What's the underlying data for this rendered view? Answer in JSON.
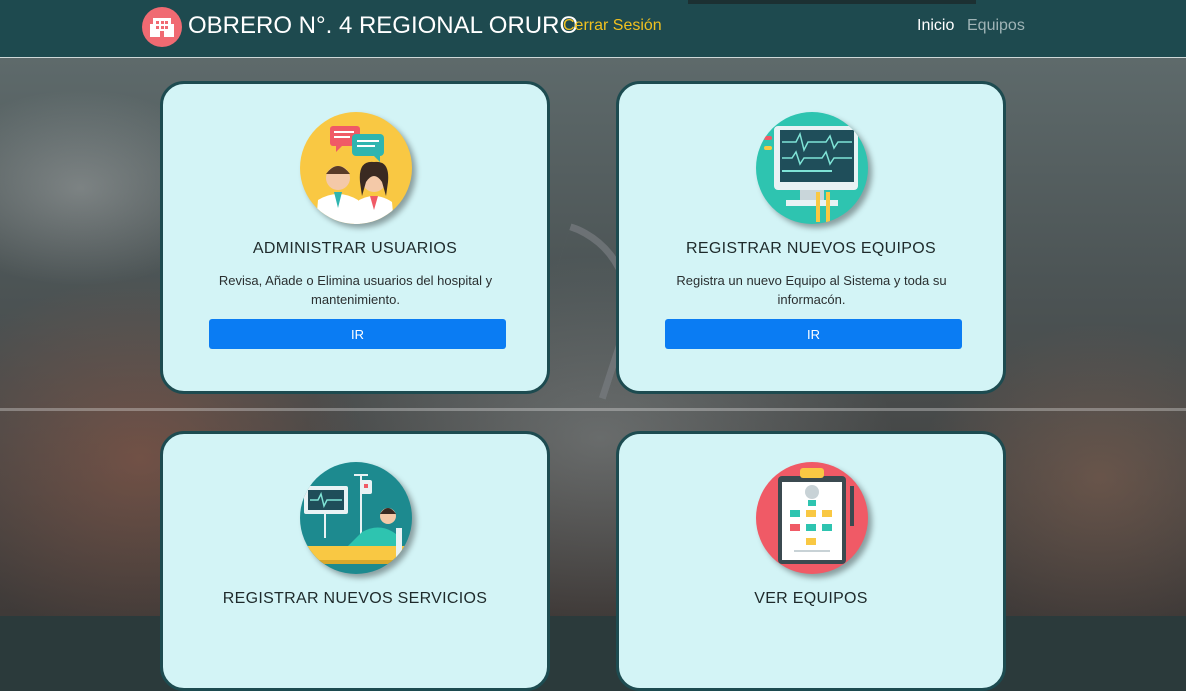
{
  "navbar": {
    "brand_title": "OBRERO N°. 4 REGIONAL ORURO",
    "logout_label": "Cerrar Sesión",
    "links": [
      {
        "label": "Inicio"
      },
      {
        "label": "Equipos"
      }
    ]
  },
  "cards": [
    {
      "icon": "doctors-chat-icon",
      "title": "ADMINISTRAR USUARIOS",
      "description": "Revisa, Añade o Elimina usuarios del hospital y mantenimiento.",
      "button_label": "IR"
    },
    {
      "icon": "monitor-ecg-icon",
      "title": "REGISTRAR NUEVOS EQUIPOS",
      "description": "Registra un nuevo Equipo al Sistema y toda su informacón.",
      "button_label": "IR"
    },
    {
      "icon": "patient-bed-icon",
      "title": "REGISTRAR NUEVOS SERVICIOS"
    },
    {
      "icon": "clipboard-flowchart-icon",
      "title": "VER EQUIPOS"
    }
  ],
  "colors": {
    "navbar": "#1e4a4f",
    "card_bg": "#d3f4f6",
    "card_border": "#1d4b50",
    "button": "#0a7cf3",
    "logout": "#f0c020"
  }
}
